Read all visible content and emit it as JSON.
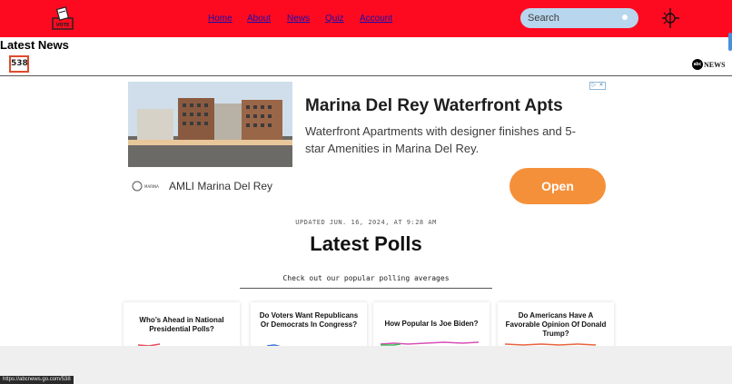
{
  "nav": {
    "links": [
      {
        "label": "Home"
      },
      {
        "label": "About"
      },
      {
        "label": "News"
      },
      {
        "label": "Quiz"
      },
      {
        "label": "Account"
      }
    ],
    "logo_text": "VOTE",
    "search_placeholder": "Search"
  },
  "section_heading": "Latest News",
  "embed": {
    "site_logo": "538",
    "partner_logo": "NEWS",
    "partner_mark": "abc"
  },
  "ad": {
    "title": "Marina Del Rey Waterfront Apts",
    "description": "Waterfront Apartments with designer finishes and 5-star Amenities in Marina Del Rey.",
    "advertiser": "AMLI Marina Del Rey",
    "advertiser_logo_text": "MARINA",
    "cta": "Open",
    "badge_icons": [
      "adchoices-icon",
      "close-icon"
    ]
  },
  "polls": {
    "updated": "UPDATED JUN. 16, 2024, AT 9:28 AM",
    "title": "Latest Polls",
    "subtitle": "Check out our popular polling averages",
    "cards": [
      {
        "title": "Who’s Ahead in National Presidential Polls?"
      },
      {
        "title": "Do Voters Want Republicans Or Democrats In Congress?"
      },
      {
        "title": "How Popular Is Joe Biden?"
      },
      {
        "title": "Do Americans Have A Favorable Opinion Of Donald Trump?"
      }
    ]
  },
  "status_bar": {
    "url": "https://abcnews.go.com/538"
  },
  "colors": {
    "topbar": "#fd0a21",
    "search_bg": "#b8d6ee",
    "cta": "#f5903a",
    "link": "#1a0dab"
  }
}
